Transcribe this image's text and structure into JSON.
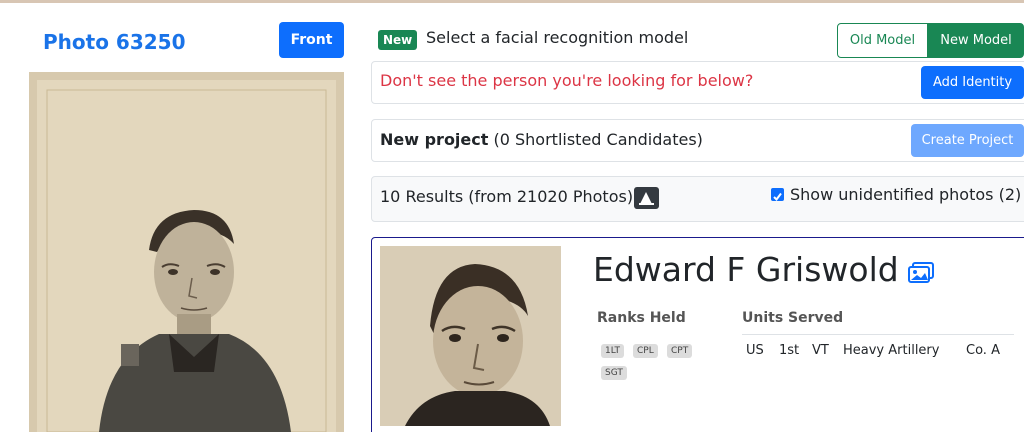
{
  "photo": {
    "title": "Photo 63250",
    "side_button": "Front"
  },
  "model": {
    "badge": "New",
    "prompt": "Select a facial recognition model",
    "options": [
      "Old Model",
      "New Model"
    ],
    "selected": "New Model"
  },
  "identity": {
    "message": "Don't see the person you're looking for below?",
    "button": "Add Identity"
  },
  "project": {
    "title": "New project",
    "subtitle": "(0 Shortlisted Candidates)",
    "button": "Create Project"
  },
  "results": {
    "summary": "10 Results (from 21020 Photos)",
    "show_label": "Show unidentified photos (2)",
    "show_checked": true
  },
  "person": {
    "name": "Edward F Griswold",
    "ranks_title": "Ranks Held",
    "units_title": "Units Served",
    "ranks": [
      "1LT",
      "CPL",
      "CPT",
      "SGT"
    ],
    "unit": [
      "US",
      "1st",
      "VT",
      "Heavy Artillery",
      "Co. A"
    ]
  },
  "colors": {
    "primary": "#0d6efd",
    "success": "#198754",
    "danger": "#dc3545",
    "title_blue": "#1a73e8"
  }
}
